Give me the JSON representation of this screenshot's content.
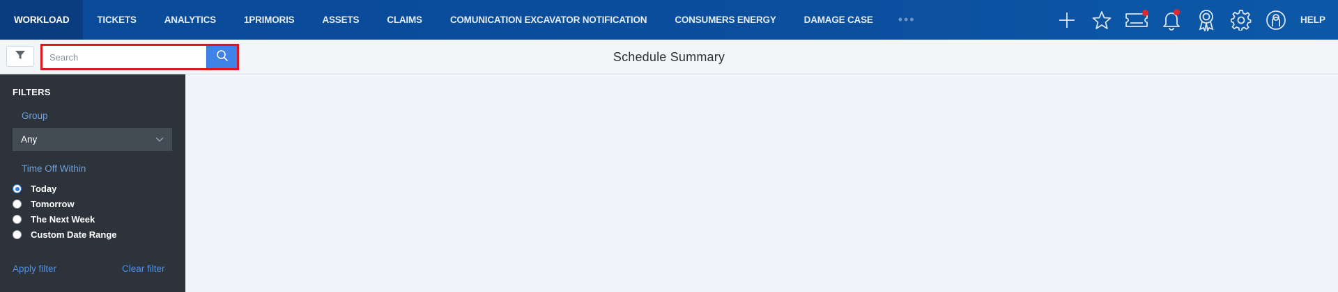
{
  "nav": {
    "items": [
      {
        "label": "WORKLOAD",
        "active": true
      },
      {
        "label": "TICKETS",
        "active": false
      },
      {
        "label": "ANALYTICS",
        "active": false
      },
      {
        "label": "1PRIMORIS",
        "active": false
      },
      {
        "label": "ASSETS",
        "active": false
      },
      {
        "label": "CLAIMS",
        "active": false
      },
      {
        "label": "COMUNICATION EXCAVATOR NOTIFICATION",
        "active": false
      },
      {
        "label": "CONSUMERS ENERGY",
        "active": false
      },
      {
        "label": "DAMAGE CASE",
        "active": false
      }
    ],
    "more": "•••",
    "icons": [
      "plus-icon",
      "star-icon",
      "ticket-icon",
      "bell-icon",
      "award-icon",
      "gear-icon",
      "user-icon"
    ],
    "help_label": "HELP",
    "badge_color": "#e3262b"
  },
  "toolbar": {
    "search_placeholder": "Search",
    "search_value": "",
    "title": "Schedule Summary"
  },
  "sidebar": {
    "heading": "FILTERS",
    "group_label": "Group",
    "group_value": "Any",
    "timeoff_label": "Time Off Within",
    "options": [
      {
        "label": "Today",
        "checked": true
      },
      {
        "label": "Tomorrow",
        "checked": false
      },
      {
        "label": "The Next Week",
        "checked": false
      },
      {
        "label": "Custom Date Range",
        "checked": false
      }
    ],
    "apply_label": "Apply filter",
    "clear_label": "Clear filter"
  },
  "colors": {
    "nav_bg": "#0b4f9e",
    "accent": "#3f82e8",
    "highlight_border": "#e0141b",
    "sidebar_bg": "#2d333b",
    "link": "#4e8fe4"
  }
}
